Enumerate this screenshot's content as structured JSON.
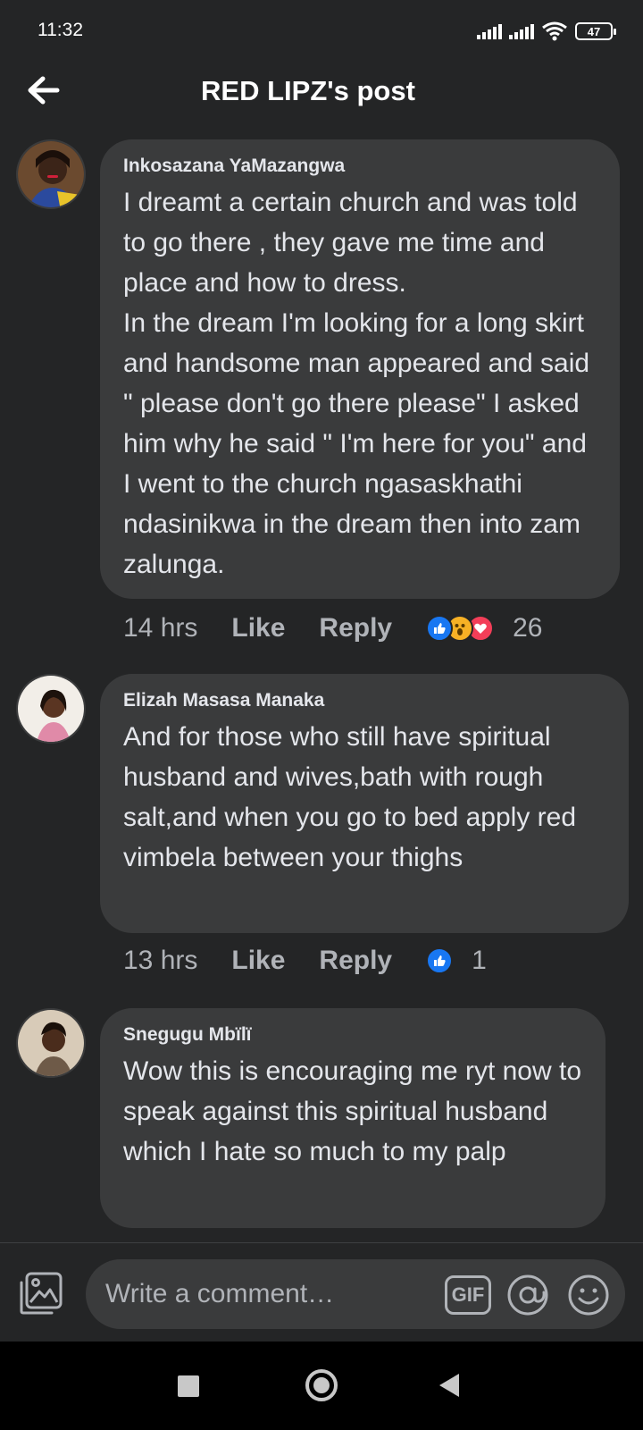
{
  "status_bar": {
    "time": "11:32",
    "battery": "47"
  },
  "header": {
    "title": "RED LIPZ's post"
  },
  "comments": [
    {
      "author": "Inkosazana YaMazangwa",
      "text": "I dreamt a certain church and was told to go there , they gave me time and place and how to dress.\nIn the dream I'm looking for a long skirt and handsome man appeared and said \" please don't go there please\" I asked him why he said \" I'm here for you\" and I went to the church ngasaskhathi ndasinikwa in the dream then into zam zalunga.",
      "time": "14 hrs",
      "like_label": "Like",
      "reply_label": "Reply",
      "reaction_count": "26",
      "reactions": [
        "like-icon",
        "wow-icon",
        "love-icon"
      ]
    },
    {
      "author": "Elizah Masasa Manaka",
      "text": "And for those who still have spiritual husband and wives,bath with rough salt,and when you go to bed apply red vimbela between your thighs",
      "time": "13 hrs",
      "like_label": "Like",
      "reply_label": "Reply",
      "reaction_count": "1",
      "reactions": [
        "like-icon"
      ]
    },
    {
      "author": "Snegugu Mbïlï",
      "text": "Wow this is encouraging me ryt now to speak against this spiritual husband which I hate so much to my palp"
    }
  ],
  "composer": {
    "placeholder": "Write a comment…",
    "gif_label": "GIF"
  },
  "colors": {
    "background": "#242526",
    "bubble": "#3a3b3c",
    "like_blue": "#1877f2",
    "wow_yellow": "#f7b125",
    "love_red": "#f33e58"
  }
}
